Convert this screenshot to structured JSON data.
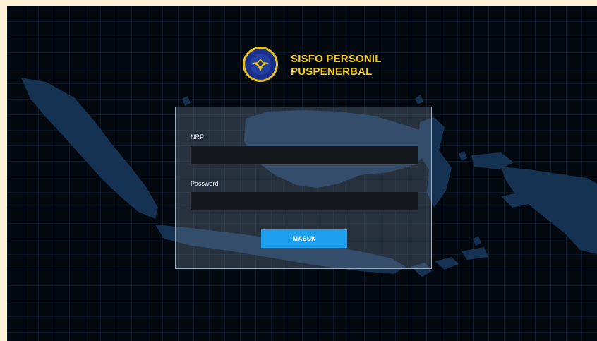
{
  "app": {
    "title_line1": "SISFO PERSONIL",
    "title_line2": "PUSPENERBAL",
    "colors": {
      "accent": "#f3cc17",
      "button": "#1ea0f0",
      "background": "#04080f",
      "frame": "#fdf1d8"
    }
  },
  "login": {
    "nrp_label": "NRP",
    "nrp_value": "",
    "password_label": "Password",
    "password_value": "",
    "submit_label": "MASUK"
  },
  "icons": {
    "logo": "puspenerbal-emblem"
  }
}
